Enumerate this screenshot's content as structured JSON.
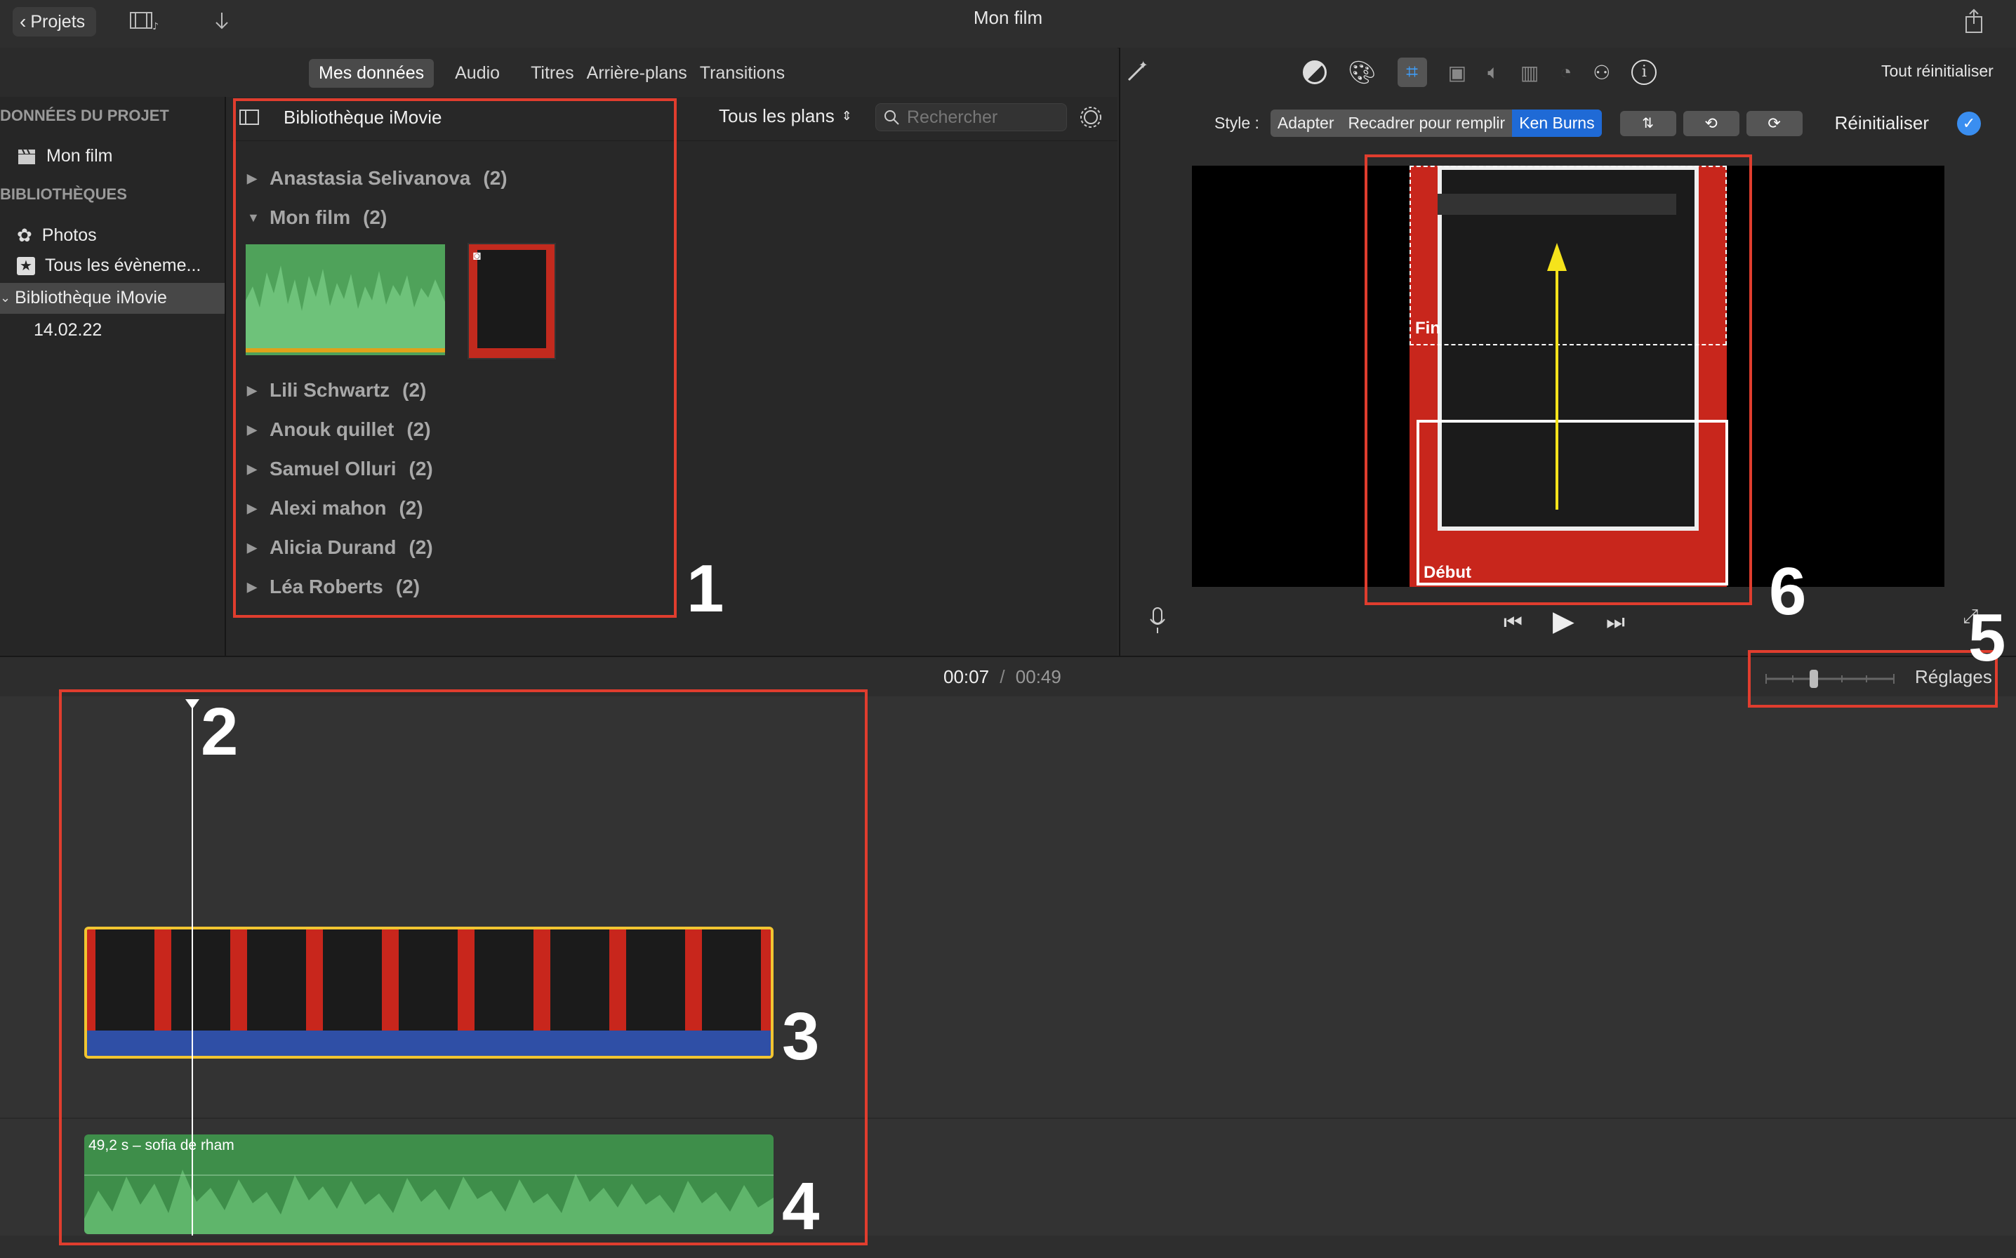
{
  "window": {
    "title": "Mon film",
    "back_label": "Projets"
  },
  "tabs": [
    "Mes données",
    "Audio",
    "Titres",
    "Arrière-plans",
    "Transitions"
  ],
  "sidebar": {
    "section_project": "DONNÉES DU PROJET",
    "project_item": "Mon film",
    "section_libraries": "BIBLIOTHÈQUES",
    "items": [
      "Photos",
      "Tous les évèneme...",
      "Bibliothèque iMovie",
      "14.02.22"
    ]
  },
  "browser": {
    "title": "Bibliothèque iMovie",
    "filter": "Tous les plans",
    "search_placeholder": "Rechercher",
    "groups": [
      {
        "name": "Anastasia Selivanova",
        "count": "(2)",
        "expanded": false
      },
      {
        "name": "Mon film",
        "count": "(2)",
        "expanded": true
      },
      {
        "name": "Lili Schwartz",
        "count": "(2)",
        "expanded": false
      },
      {
        "name": "Anouk quillet",
        "count": "(2)",
        "expanded": false
      },
      {
        "name": "Samuel Olluri",
        "count": "(2)",
        "expanded": false
      },
      {
        "name": "Alexi mahon",
        "count": "(2)",
        "expanded": false
      },
      {
        "name": "Alicia Durand",
        "count": "(2)",
        "expanded": false
      },
      {
        "name": "Léa Roberts",
        "count": "(2)",
        "expanded": false
      }
    ]
  },
  "viewer": {
    "reset_all": "Tout réinitialiser",
    "style_label": "Style :",
    "style_options": [
      "Adapter",
      "Recadrer pour remplir",
      "Ken Burns"
    ],
    "selected_style": "Ken Burns",
    "reset": "Réinitialiser",
    "end_label": "Fin",
    "start_label": "Début"
  },
  "timeline": {
    "current_time": "00:07",
    "separator": "/",
    "total_time": "00:49",
    "settings": "Réglages",
    "audio_clip_label": "49,2 s – sofia de rham"
  },
  "callouts": [
    "1",
    "2",
    "3",
    "4",
    "5",
    "6"
  ],
  "colors": {
    "accent": "#1f6ad6",
    "callout": "#e03d2e",
    "clip_border": "#f2c531",
    "audio": "#3e8e4a"
  }
}
